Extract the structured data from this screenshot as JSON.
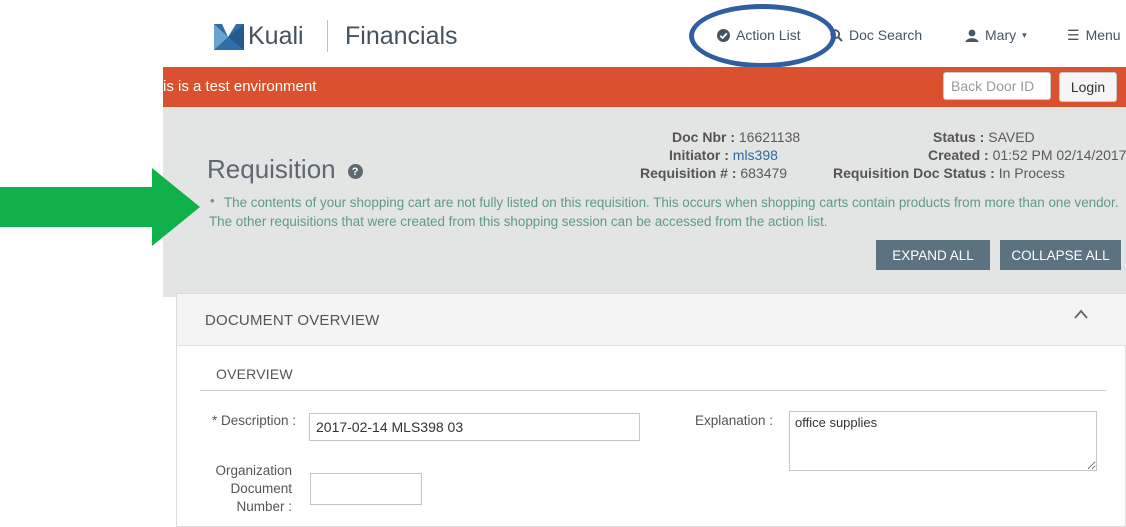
{
  "header": {
    "brand": "Kuali",
    "product": "Financials",
    "nav": {
      "action_list": "Action List",
      "doc_search": "Doc Search",
      "user": "Mary",
      "menu": "Menu"
    }
  },
  "env_bar": {
    "message": "is is a test environment",
    "backdoor_placeholder": "Back Door ID",
    "login_label": "Login"
  },
  "document": {
    "title": "Requisition",
    "meta": {
      "doc_nbr_label": "Doc Nbr :",
      "doc_nbr": "16621138",
      "initiator_label": "Initiator :",
      "initiator": "mls398",
      "requisition_num_label": "Requisition # :",
      "requisition_num": "683479",
      "status_label": "Status :",
      "status": "SAVED",
      "created_label": "Created :",
      "created": "01:52 PM 02/14/2017",
      "req_doc_status_label": "Requisition Doc Status :",
      "req_doc_status": "In Process"
    },
    "notice": "The contents of your shopping cart are not fully listed on this requisition. This occurs when shopping carts contain products from more than one vendor. The other requisitions that were created from this shopping session can be accessed from the action list.",
    "expand_all": "EXPAND ALL",
    "collapse_all": "COLLAPSE ALL"
  },
  "overview": {
    "panel_title": "DOCUMENT OVERVIEW",
    "section_title": "OVERVIEW",
    "description_label": "* Description :",
    "description_value": "2017-02-14 MLS398 03",
    "explanation_label": "Explanation :",
    "explanation_value": "office supplies",
    "org_doc_number_label": "Organization Document Number :",
    "org_doc_number_value": ""
  },
  "colors": {
    "env_bar": "#d9512f",
    "header_bg": "#e3e4e4",
    "button": "#5b7381",
    "annotation_circle": "#2f5fa0",
    "annotation_arrow": "#10b04a"
  },
  "icons": [
    "kuali-logo-icon",
    "check-circle-icon",
    "search-icon",
    "user-icon",
    "caret-down-icon",
    "hamburger-icon",
    "help-icon",
    "chevron-up-icon",
    "green-arrow-annotation"
  ]
}
